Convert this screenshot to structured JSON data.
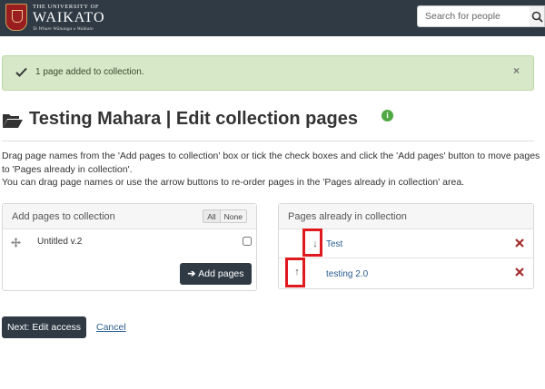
{
  "header": {
    "logo_line1": "THE UNIVERSITY OF",
    "logo_line2": "WAIKATO",
    "logo_motto": "Te Whare Wānanga o Waikato",
    "search_placeholder": "Search for people",
    "search_icon": "search-icon"
  },
  "alert": {
    "message": "1 page added to collection.",
    "close_label": "×",
    "icon": "check-icon",
    "color": "#d6e8c7"
  },
  "page": {
    "title": "Testing Mahara | Edit collection pages",
    "info_label": "i",
    "instruction_1": "Drag page names from the 'Add pages to collection' box or tick the check boxes and click the 'Add pages' button to move pages to 'Pages already in collection'.",
    "instruction_2": "You can drag page names or use the arrow buttons to re-order pages in the 'Pages already in collection' area."
  },
  "add_panel": {
    "title": "Add pages to collection",
    "all_label": "All",
    "none_label": "None",
    "items": [
      {
        "name": "Untitled v.2",
        "checked": false
      }
    ],
    "add_button_label": "Add pages",
    "add_button_arrow": "➔"
  },
  "collection_panel": {
    "title": "Pages already in collection",
    "items": [
      {
        "name": "Test",
        "arrow": "↓",
        "remove": "×"
      },
      {
        "name": "testing 2.0",
        "arrow": "↑",
        "remove": "×"
      }
    ]
  },
  "actions": {
    "next_label": "Next: Edit access",
    "cancel_label": "Cancel"
  },
  "colors": {
    "primary": "#2f3a45",
    "link": "#2a5d8f",
    "remove": "#a52a2a",
    "highlight": "#e0191f",
    "success": "#4fa844"
  }
}
